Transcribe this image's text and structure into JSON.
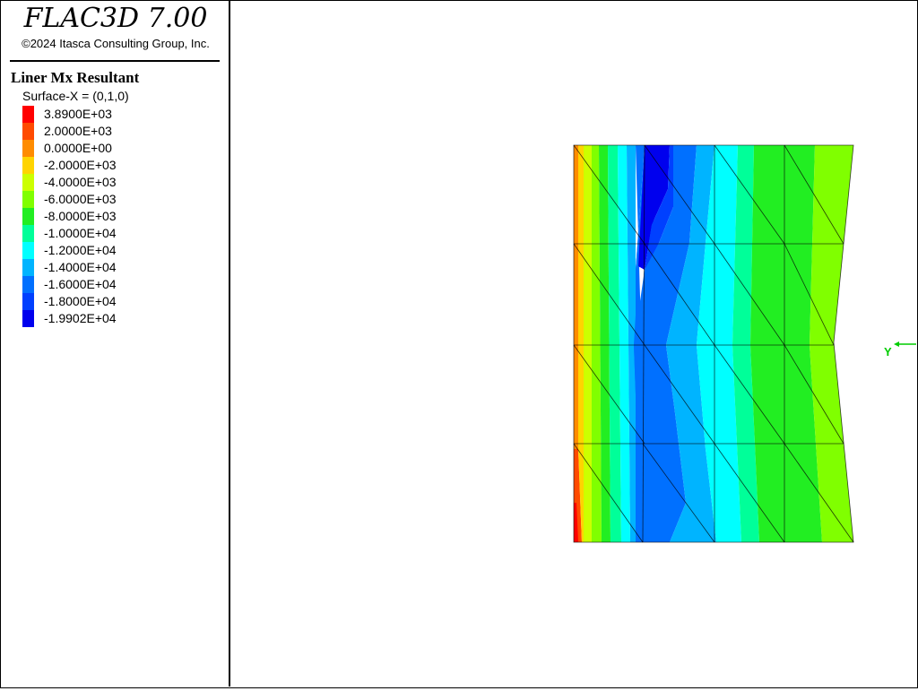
{
  "app": {
    "title": "FLAC3D 7.00",
    "copyright": "©2024 Itasca Consulting Group, Inc."
  },
  "legend": {
    "title": "Liner Mx Resultant",
    "subtitle": "Surface-X = (0,1,0)",
    "entries": [
      {
        "value": "3.8900E+03",
        "color": "#ff0000"
      },
      {
        "value": "2.0000E+03",
        "color": "#ff4a00"
      },
      {
        "value": "0.0000E+00",
        "color": "#ff8c00"
      },
      {
        "value": "-2.0000E+03",
        "color": "#ffd400"
      },
      {
        "value": "-4.0000E+03",
        "color": "#ccff00"
      },
      {
        "value": "-6.0000E+03",
        "color": "#80ff00"
      },
      {
        "value": "-8.0000E+03",
        "color": "#22ee22"
      },
      {
        "value": "-1.0000E+04",
        "color": "#00ff99"
      },
      {
        "value": "-1.2000E+04",
        "color": "#00ffff"
      },
      {
        "value": "-1.4000E+04",
        "color": "#00b4ff"
      },
      {
        "value": "-1.6000E+04",
        "color": "#0070ff"
      },
      {
        "value": "-1.8000E+04",
        "color": "#0040ff"
      },
      {
        "value": "-1.9902E+04",
        "color": "#0000ee"
      }
    ]
  },
  "viewport": {
    "axis_label": "Y",
    "axis_color": "#00cc00"
  }
}
